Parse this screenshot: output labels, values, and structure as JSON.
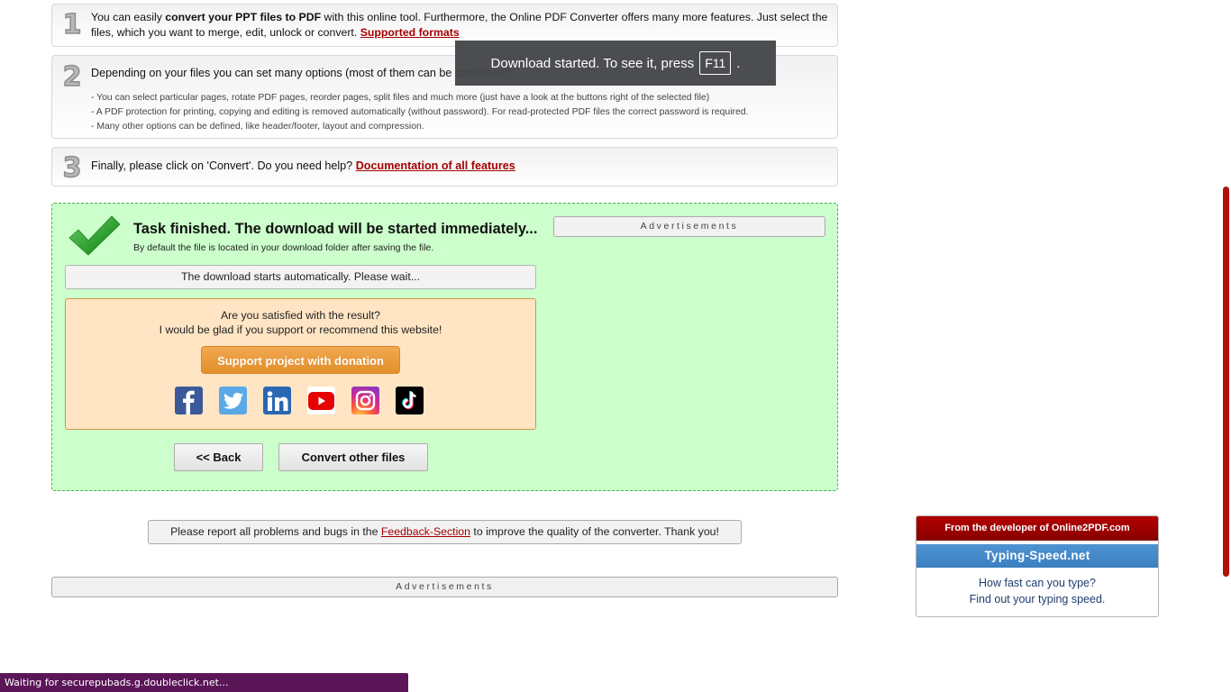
{
  "steps": [
    {
      "number": "1",
      "text_pre": "You can easily ",
      "text_bold": "convert your PPT files to PDF",
      "text_post": " with this online tool. Furthermore, the Online PDF Converter offers many more features. Just select the files, which you want to merge, edit, unlock or convert. ",
      "link": "Supported formats"
    },
    {
      "number": "2",
      "heading": "Depending on your files you can set many options (most of them can be combined!)",
      "bullets": [
        "- You can select particular pages, rotate PDF pages, reorder pages, split files and much more (just have a look at the buttons right of the selected file)",
        "- A PDF protection for printing, copying and editing is removed automatically (without password). For read-protected PDF files the correct password is required.",
        "- Many other options can be defined, like header/footer, layout and compression."
      ]
    },
    {
      "number": "3",
      "text": "Finally, please click on 'Convert'. Do you need help? ",
      "link": "Documentation of all features"
    }
  ],
  "toast": {
    "text": "Download started. To see it, press",
    "key": "F11",
    "suffix": "."
  },
  "result": {
    "title": "Task finished. The download will be started immediately...",
    "subtitle": "By default the file is located in your download folder after saving the file.",
    "wait_text": "The download starts automatically. Please wait...",
    "ad_label": "Advertisements",
    "donate": {
      "question": "Are you satisfied with the result?",
      "appeal": "I would be glad if you support or recommend this website!",
      "button": "Support project with donation",
      "socials": [
        "facebook",
        "twitter",
        "linkedin",
        "youtube",
        "instagram",
        "tiktok"
      ]
    },
    "back_button": "<< Back",
    "convert_other_button": "Convert other files"
  },
  "feedback": {
    "pre": "Please report all problems and bugs in the ",
    "link": "Feedback-Section",
    "post": " to improve the quality of the converter. Thank you!"
  },
  "ad_bottom_label": "Advertisements",
  "promo": {
    "header": "From the developer of Online2PDF.com",
    "site": "Typing-Speed.net",
    "line1": "How fast can you type?",
    "line2": "Find out your typing speed."
  },
  "status_bar": "Waiting for securepubads.g.doubleclick.net...",
  "colors": {
    "link": "#a30000",
    "success_bg": "#ccffcc",
    "donate_bg": "#ffe5c4",
    "donate_button": "#e8962f",
    "promo_red": "#9e0000",
    "promo_blue": "#4587c8",
    "status_bar": "#5b1658",
    "scrollbar": "#b01207"
  }
}
